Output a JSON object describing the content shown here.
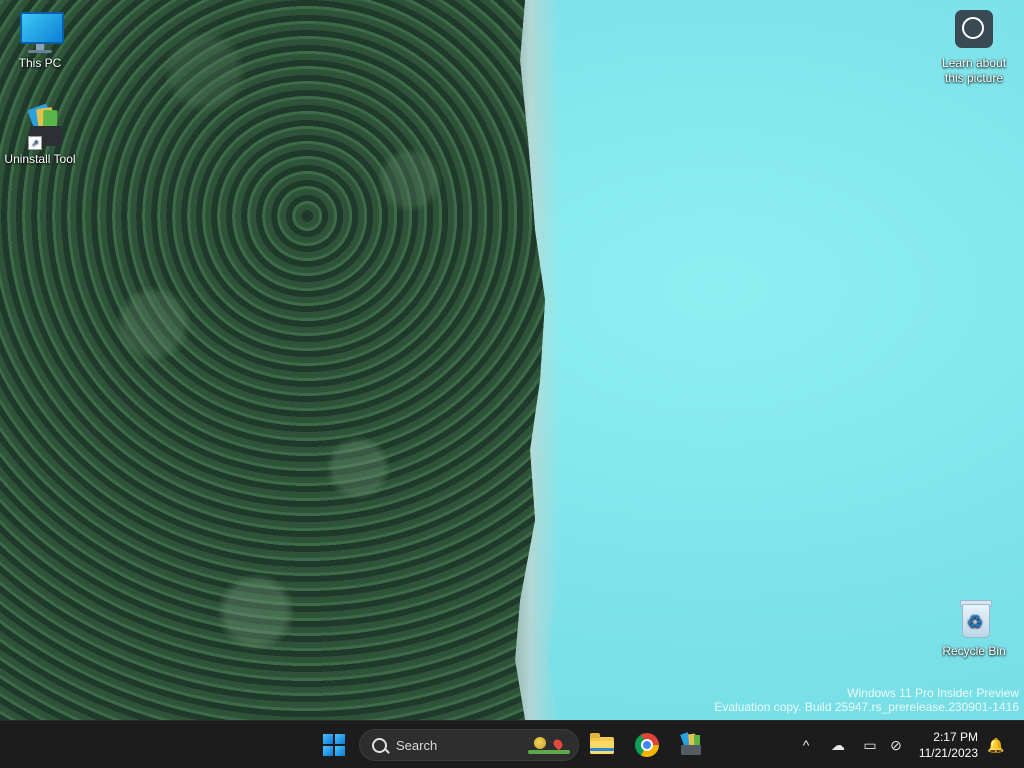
{
  "desktop": {
    "icons": [
      {
        "label": "This PC"
      },
      {
        "label": "Uninstall Tool"
      },
      {
        "label": "Learn about\nthis picture"
      },
      {
        "label": "Recycle Bin"
      }
    ],
    "watermark": {
      "line1": "Windows 11 Pro Insider Preview",
      "line2": "Evaluation copy. Build 25947.rs_prerelease.230901-1416"
    }
  },
  "taskbar": {
    "search": {
      "placeholder": "Search"
    },
    "pinned": [
      "File Explorer",
      "Google Chrome",
      "Uninstall Tool"
    ],
    "tray": {
      "time": "2:17 PM",
      "date": "11/21/2023"
    }
  },
  "colors": {
    "taskbar_bg": "#1c1c1c",
    "accent": "#4cc2ff"
  }
}
